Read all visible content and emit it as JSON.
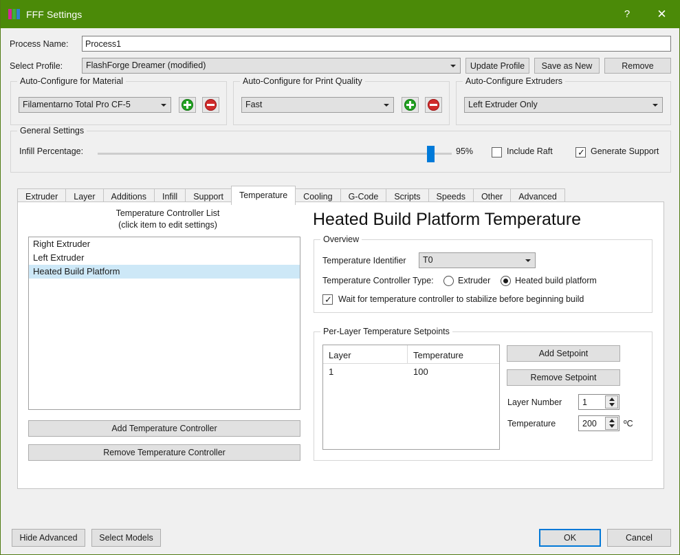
{
  "window": {
    "title": "FFF Settings",
    "help_label": "?",
    "close_label": "✕",
    "accent_color": "#4b8a08",
    "logo_colors": [
      "#d4259c",
      "#3fae3f",
      "#2f7fd0"
    ]
  },
  "form": {
    "process_name_label": "Process Name:",
    "process_name_value": "Process1",
    "select_profile_label": "Select Profile:",
    "select_profile_value": "FlashForge Dreamer (modified)",
    "update_profile_label": "Update Profile",
    "save_as_new_label": "Save as New",
    "remove_label": "Remove"
  },
  "auto_material": {
    "group_label": "Auto-Configure for Material",
    "value": "Filamentarno Total Pro CF-5",
    "add_label": "+",
    "remove_label": "−"
  },
  "auto_quality": {
    "group_label": "Auto-Configure for Print Quality",
    "value": "Fast",
    "add_label": "+",
    "remove_label": "−"
  },
  "auto_extruders": {
    "group_label": "Auto-Configure Extruders",
    "value": "Left Extruder Only"
  },
  "general_settings": {
    "group_label": "General Settings",
    "infill_label": "Infill Percentage:",
    "infill_value": "95%",
    "infill_percent": 95,
    "include_raft_label": "Include Raft",
    "include_raft_checked": false,
    "generate_support_label": "Generate Support",
    "generate_support_checked": true,
    "check_glyph": "✓"
  },
  "tabs": {
    "items": [
      {
        "label": "Extruder",
        "active": false
      },
      {
        "label": "Layer",
        "active": false
      },
      {
        "label": "Additions",
        "active": false
      },
      {
        "label": "Infill",
        "active": false
      },
      {
        "label": "Support",
        "active": false
      },
      {
        "label": "Temperature",
        "active": true
      },
      {
        "label": "Cooling",
        "active": false
      },
      {
        "label": "G-Code",
        "active": false
      },
      {
        "label": "Scripts",
        "active": false
      },
      {
        "label": "Speeds",
        "active": false
      },
      {
        "label": "Other",
        "active": false
      },
      {
        "label": "Advanced",
        "active": false
      }
    ]
  },
  "controller_panel": {
    "title_line1": "Temperature Controller List",
    "title_line2": "(click item to edit settings)",
    "items": [
      {
        "label": "Right Extruder",
        "selected": false
      },
      {
        "label": "Left Extruder",
        "selected": false
      },
      {
        "label": "Heated Build Platform",
        "selected": true
      }
    ],
    "add_button": "Add Temperature Controller",
    "remove_button": "Remove Temperature Controller"
  },
  "detail": {
    "heading": "Heated Build Platform Temperature",
    "overview": {
      "group_label": "Overview",
      "identifier_label": "Temperature Identifier",
      "identifier_value": "T0",
      "type_label": "Temperature Controller Type:",
      "radio_extruder_label": "Extruder",
      "radio_extruder_selected": false,
      "radio_platform_label": "Heated build platform",
      "radio_platform_selected": true,
      "wait_label": "Wait for temperature controller to stabilize before beginning build",
      "wait_checked": true
    },
    "setpoints": {
      "group_label": "Per-Layer Temperature Setpoints",
      "columns": [
        "Layer",
        "Temperature"
      ],
      "rows": [
        [
          "1",
          "100"
        ]
      ],
      "add_button": "Add Setpoint",
      "remove_button": "Remove Setpoint",
      "layer_number_label": "Layer Number",
      "layer_number_value": "1",
      "temperature_label": "Temperature",
      "temperature_value": "200",
      "temperature_unit": "ºC"
    }
  },
  "footer": {
    "hide_advanced_label": "Hide Advanced",
    "select_models_label": "Select Models",
    "ok_label": "OK",
    "cancel_label": "Cancel"
  }
}
